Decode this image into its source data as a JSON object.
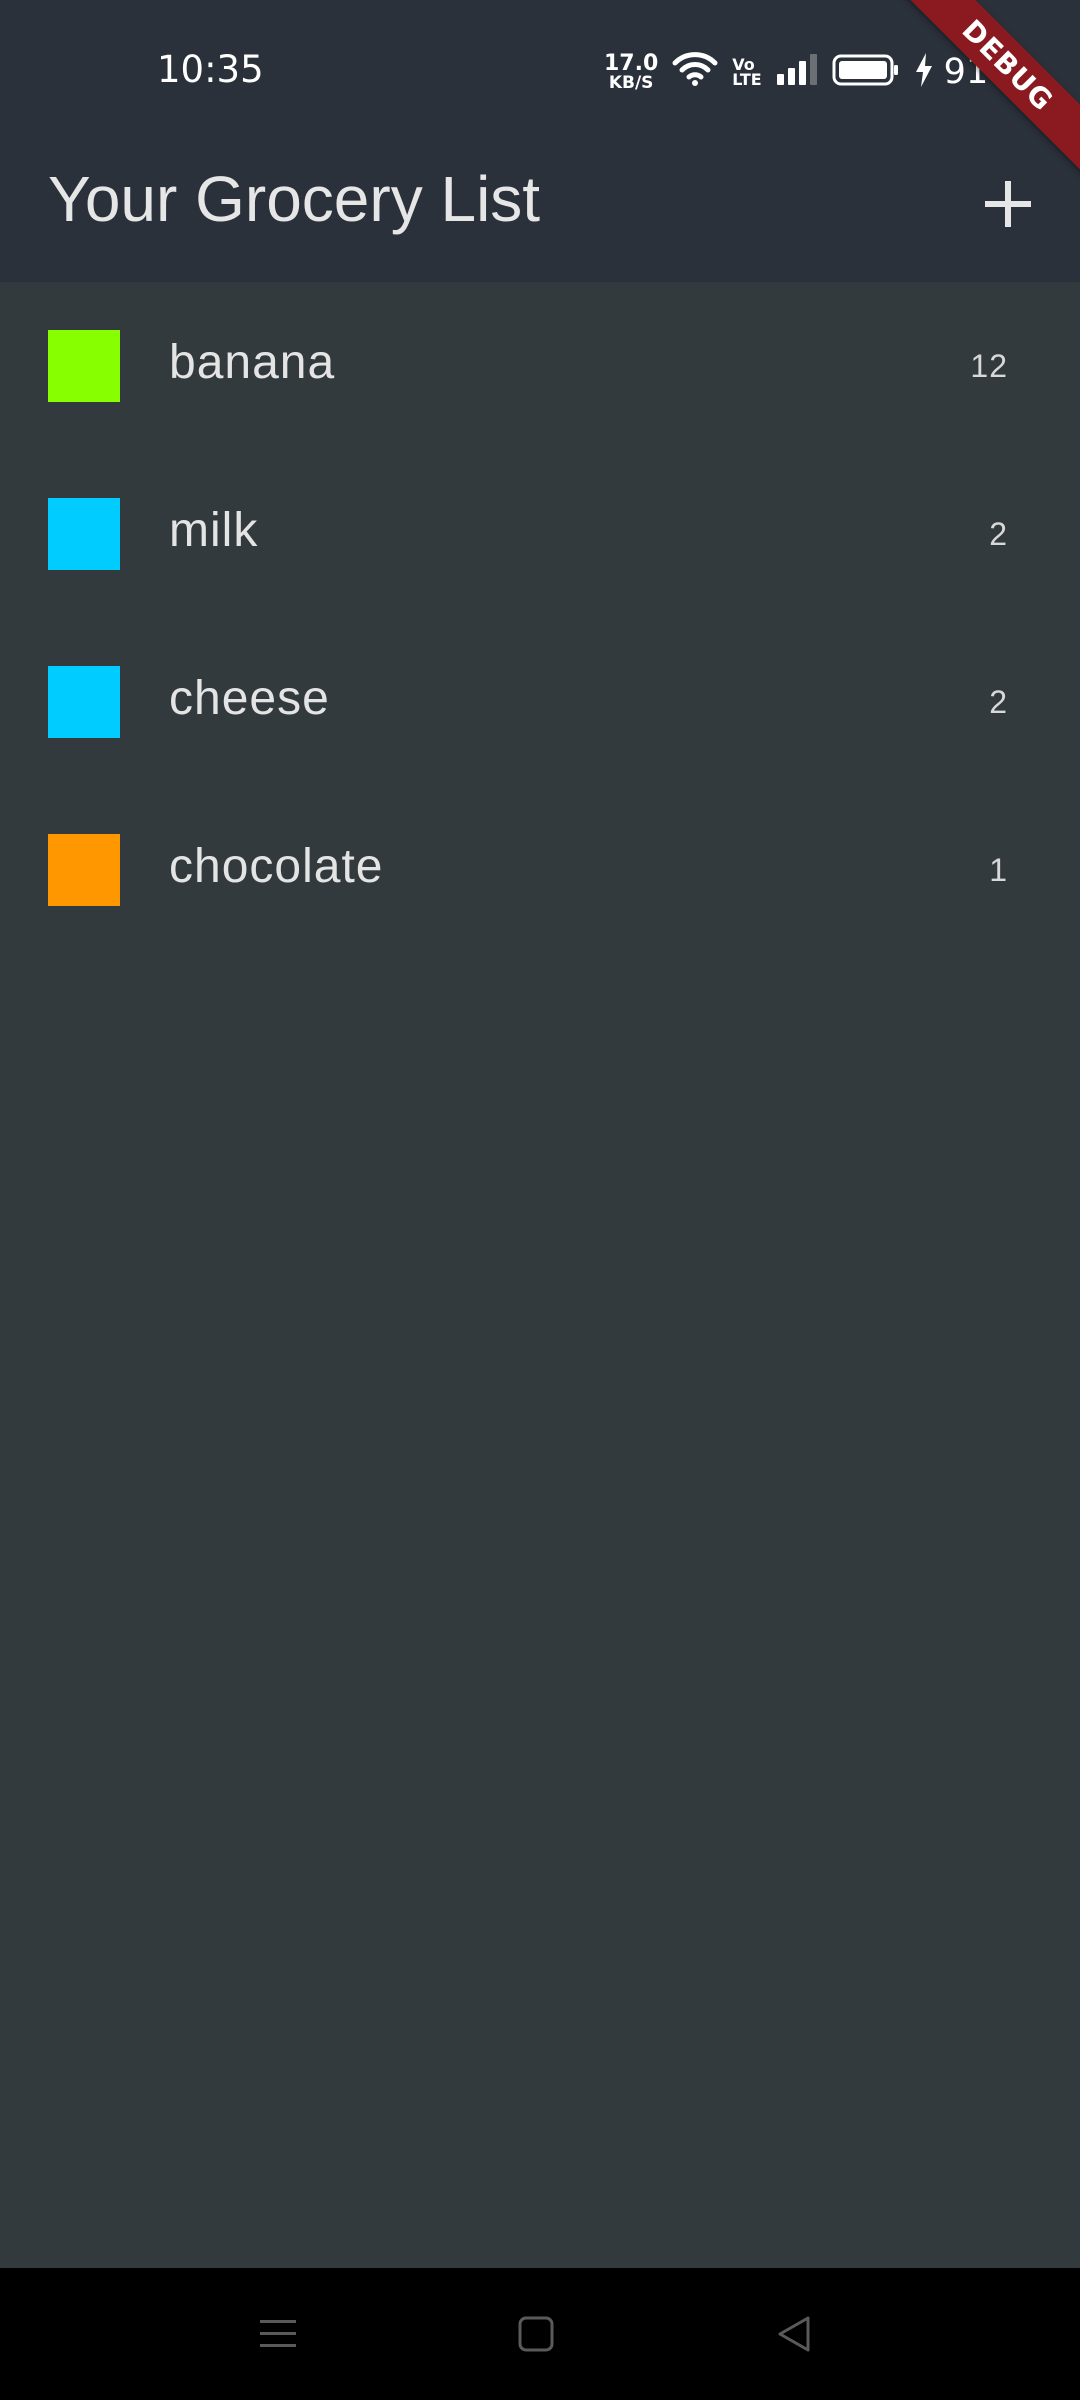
{
  "status_bar": {
    "time": "10:35",
    "net_speed_value": "17.0",
    "net_speed_unit": "KB/S",
    "volte_top": "Vo",
    "volte_bottom": "LTE",
    "battery_percent": "91%"
  },
  "debug_banner": {
    "label": "DEBUG",
    "color": "#8a1a1f"
  },
  "app_bar": {
    "title": "Your Grocery List",
    "add_icon": "plus-icon"
  },
  "grocery_items": [
    {
      "name": "banana",
      "quantity": "12",
      "color": "#88ff00"
    },
    {
      "name": "milk",
      "quantity": "2",
      "color": "#00ccff"
    },
    {
      "name": "cheese",
      "quantity": "2",
      "color": "#00ccff"
    },
    {
      "name": "chocolate",
      "quantity": "1",
      "color": "#ff9800"
    }
  ],
  "nav_bar": {
    "buttons": [
      "menu-icon",
      "home-icon",
      "back-icon"
    ]
  },
  "colors": {
    "app_bar_bg": "#2a313a",
    "body_bg": "#323a3d"
  }
}
